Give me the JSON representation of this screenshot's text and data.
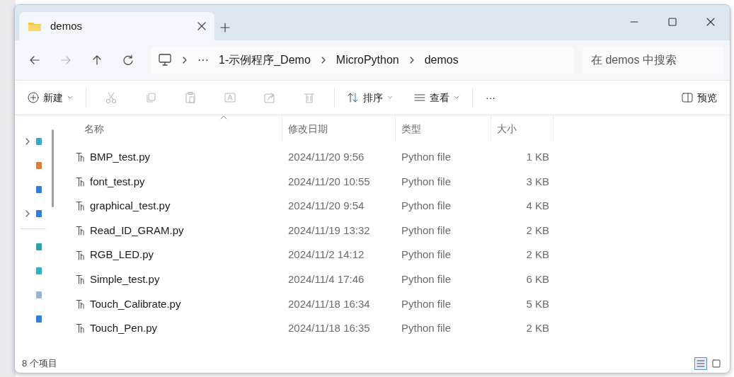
{
  "window": {
    "tab": {
      "title": "demos"
    }
  },
  "address_bar": {
    "overflow": "···",
    "breadcrumbs": [
      "1-示例程序_Demo",
      "MicroPython",
      "demos"
    ]
  },
  "search": {
    "placeholder": "在 demos 中搜索"
  },
  "nav_buttons": [
    {
      "kind": "back",
      "disabled": false
    },
    {
      "kind": "forward",
      "disabled": true
    },
    {
      "kind": "up",
      "disabled": false
    },
    {
      "kind": "refresh",
      "disabled": false
    }
  ],
  "toolbar": {
    "new_label": "新建",
    "actions": [
      {
        "kind": "cut",
        "disabled": true
      },
      {
        "kind": "copy",
        "disabled": true
      },
      {
        "kind": "paste",
        "disabled": true
      },
      {
        "kind": "rename",
        "disabled": true
      },
      {
        "kind": "share",
        "disabled": true
      },
      {
        "kind": "delete",
        "disabled": true
      }
    ],
    "sort_label": "排序",
    "view_label": "查看",
    "more": "···",
    "preview_label": "预览"
  },
  "table": {
    "columns": [
      {
        "label": "名称",
        "sorted": true
      },
      {
        "label": "修改日期",
        "sorted": false
      },
      {
        "label": "类型",
        "sorted": false
      },
      {
        "label": "大小",
        "sorted": false
      }
    ],
    "rows": [
      {
        "name": "BMP_test.py",
        "modified": "2024/11/20 9:56",
        "type": "Python file",
        "size": "1 KB"
      },
      {
        "name": "font_test.py",
        "modified": "2024/11/20 10:55",
        "type": "Python file",
        "size": "3 KB"
      },
      {
        "name": "graphical_test.py",
        "modified": "2024/11/20 9:54",
        "type": "Python file",
        "size": "4 KB"
      },
      {
        "name": "Read_ID_GRAM.py",
        "modified": "2024/11/19 13:32",
        "type": "Python file",
        "size": "2 KB"
      },
      {
        "name": "RGB_LED.py",
        "modified": "2024/11/2 14:12",
        "type": "Python file",
        "size": "2 KB"
      },
      {
        "name": "Simple_test.py",
        "modified": "2024/11/4 17:46",
        "type": "Python file",
        "size": "6 KB"
      },
      {
        "name": "Touch_Calibrate.py",
        "modified": "2024/11/18 16:34",
        "type": "Python file",
        "size": "5 KB"
      },
      {
        "name": "Touch_Pen.py",
        "modified": "2024/11/18 16:35",
        "type": "Python file",
        "size": "2 KB"
      }
    ]
  },
  "status_bar": {
    "count": "8 个项目",
    "view_buttons": [
      {
        "kind": "details",
        "selected": true
      },
      {
        "kind": "tiles",
        "selected": false
      }
    ]
  }
}
